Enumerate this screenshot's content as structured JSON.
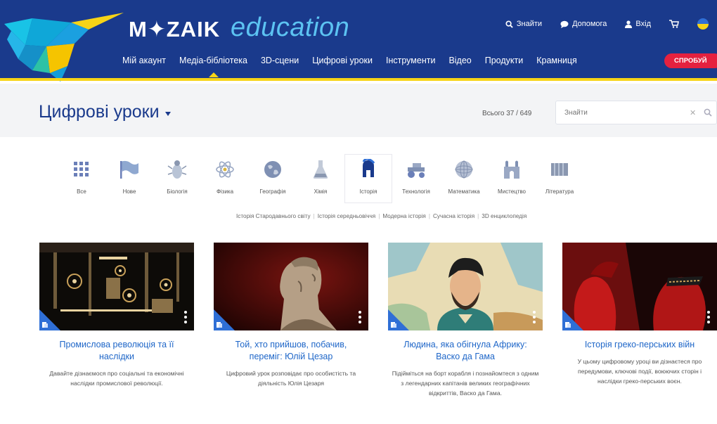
{
  "header": {
    "logo_brand": "M✦ZAIK",
    "logo_suffix": "education",
    "top_links": {
      "search": "Знайти",
      "help": "Допомога",
      "login": "Вхід"
    },
    "nav": [
      "Мій акаунт",
      "Медіа-бібліотека",
      "3D-сцени",
      "Цифрові уроки",
      "Інструменти",
      "Відео",
      "Продукти",
      "Крамниця"
    ],
    "try_button": "СПРОБУЙ"
  },
  "titlebar": {
    "title": "Цифрові уроки",
    "count": "Всього 37 / 649",
    "search_placeholder": "Знайти",
    "clear_glyph": "✕"
  },
  "categories": [
    {
      "label": "Все",
      "icon": "grid-icon"
    },
    {
      "label": "Нове",
      "icon": "flag-icon"
    },
    {
      "label": "Біологія",
      "icon": "beetle-icon"
    },
    {
      "label": "Фізика",
      "icon": "atom-icon"
    },
    {
      "label": "Географія",
      "icon": "globe-icon"
    },
    {
      "label": "Хімія",
      "icon": "flask-icon"
    },
    {
      "label": "Історія",
      "icon": "helmet-icon"
    },
    {
      "label": "Технологія",
      "icon": "tractor-icon"
    },
    {
      "label": "Математика",
      "icon": "sphere-icon"
    },
    {
      "label": "Мистецтво",
      "icon": "palace-icon"
    },
    {
      "label": "Література",
      "icon": "book-icon"
    }
  ],
  "subcategories": [
    "Історія Стародавнього світу",
    "Історія середньовіччя",
    "Модерна історія",
    "Сучасна історія",
    "3D енциклопедія"
  ],
  "cards": [
    {
      "title": "Промислова революція та її наслідки",
      "desc": "Давайте дізнаємося про соціальні та економічні наслідки промислової революції."
    },
    {
      "title": "Той, хто прийшов, побачив, переміг: Юлій Цезар",
      "desc": "Цифровий урок розповідає про особистість та діяльність Юлія Цезаря"
    },
    {
      "title": "Людина, яка обігнула Африку: Васко да Гама",
      "desc": "Підійміться на борт корабля і познайомтеся з одним з легендарних капітанів великих географічних відкриттів, Васко да Гама."
    },
    {
      "title": "Історія греко-перських війн",
      "desc": "У цьому цифровому уроці ви дізнаєтеся про передумови, ключові події, воюючих сторін і наслідки греко-перських воєн."
    }
  ],
  "colors": {
    "header_bg": "#1a3a8c",
    "accent_yellow": "#f7d417",
    "accent_red": "#e5213f",
    "link_blue": "#1e66c8"
  }
}
